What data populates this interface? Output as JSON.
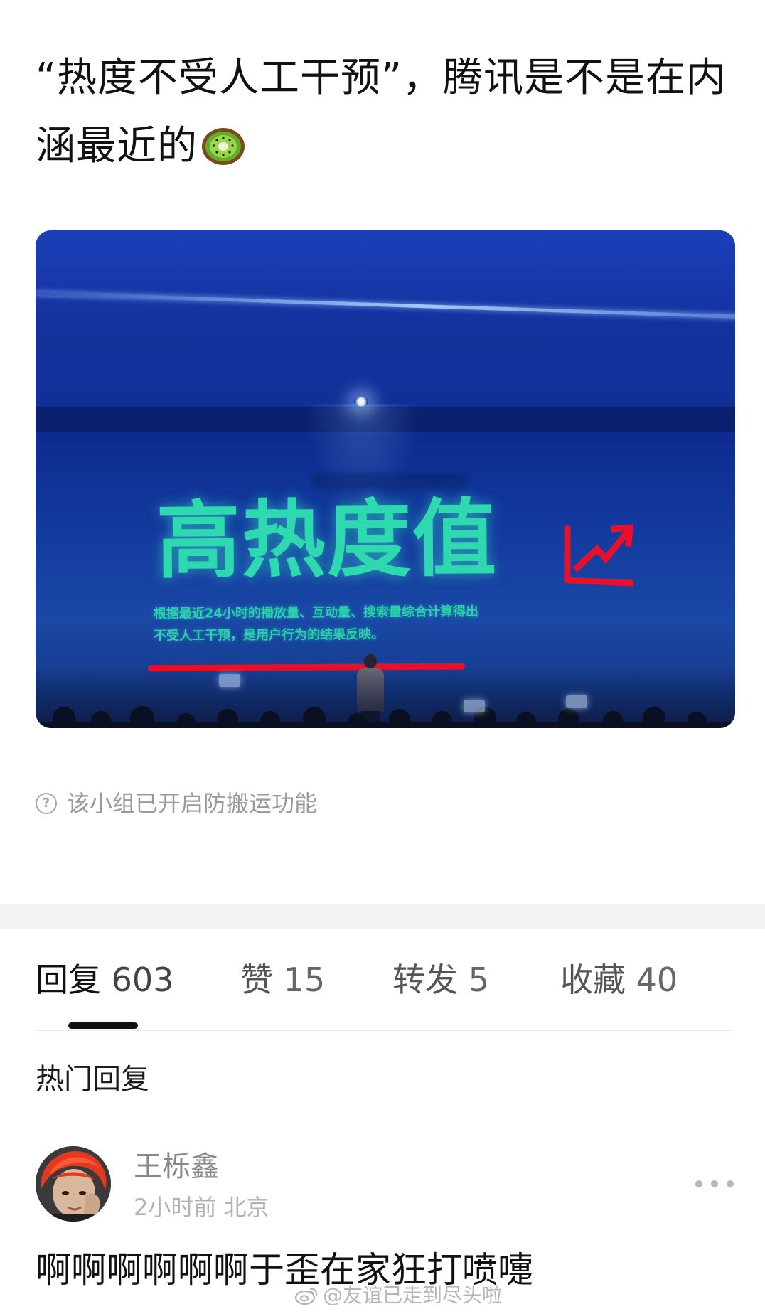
{
  "post": {
    "title": "“热度不受人工干预”，腾讯是不是在内涵最近的",
    "title_emoji": "kiwi-emoji",
    "image": {
      "screen_heading": "高热度值",
      "screen_subtext_line1": "根据最近24小时的播放量、互动量、搜索量综合计算得出",
      "screen_subtext_line2": "不受人工干预，是用户行为的结果反映。",
      "accent_colors": {
        "heading": "#2fd9b0",
        "underline": "#e8102a",
        "trend_arrow": "#e8102a"
      }
    },
    "notice_icon": "question-circle-icon",
    "notice": "该小组已开启防搬运功能"
  },
  "tabs": [
    {
      "label": "回复",
      "count": "603",
      "active": true
    },
    {
      "label": "赞",
      "count": "15",
      "active": false
    },
    {
      "label": "转发",
      "count": "5",
      "active": false
    },
    {
      "label": "收藏",
      "count": "40",
      "active": false
    }
  ],
  "hot_replies": {
    "heading": "热门回复",
    "items": [
      {
        "username": "王栎鑫",
        "time": "2小时前",
        "location": "北京",
        "text": "啊啊啊啊啊啊于歪在家狂打喷嚏",
        "more_icon": "more-dots-icon"
      }
    ]
  },
  "watermark": {
    "icon": "weibo-icon",
    "text": "@友谊已走到尽头啦"
  }
}
